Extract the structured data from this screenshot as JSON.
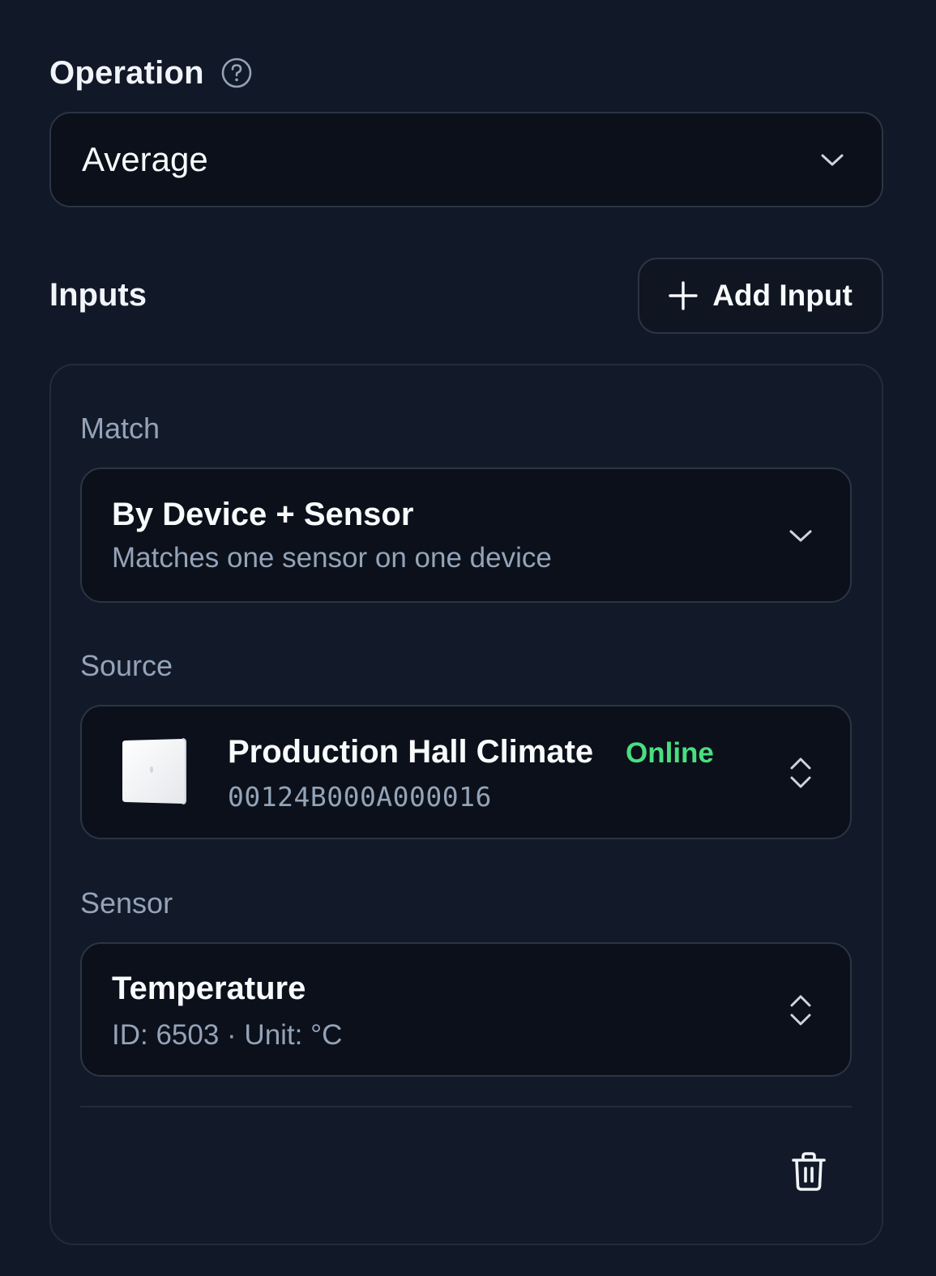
{
  "operation": {
    "label": "Operation",
    "help_icon": "help-circle-icon",
    "selected": "Average"
  },
  "inputs": {
    "title": "Inputs",
    "add_button_label": "Add Input",
    "add_icon": "plus-icon"
  },
  "input_card": {
    "match": {
      "label": "Match",
      "selected_title": "By Device + Sensor",
      "selected_description": "Matches one sensor on one device"
    },
    "source": {
      "label": "Source",
      "device_name": "Production Hall Climate",
      "status": "Online",
      "device_id": "00124B000A000016",
      "thumbnail": "device-thumbnail"
    },
    "sensor": {
      "label": "Sensor",
      "name": "Temperature",
      "details": "ID: 6503 · Unit: °C"
    },
    "delete_icon": "trash-icon"
  },
  "colors": {
    "background": "#111827",
    "field_background": "#0b101a",
    "border": "#2b3544",
    "muted_text": "#94a3b8",
    "online": "#4ade80"
  }
}
